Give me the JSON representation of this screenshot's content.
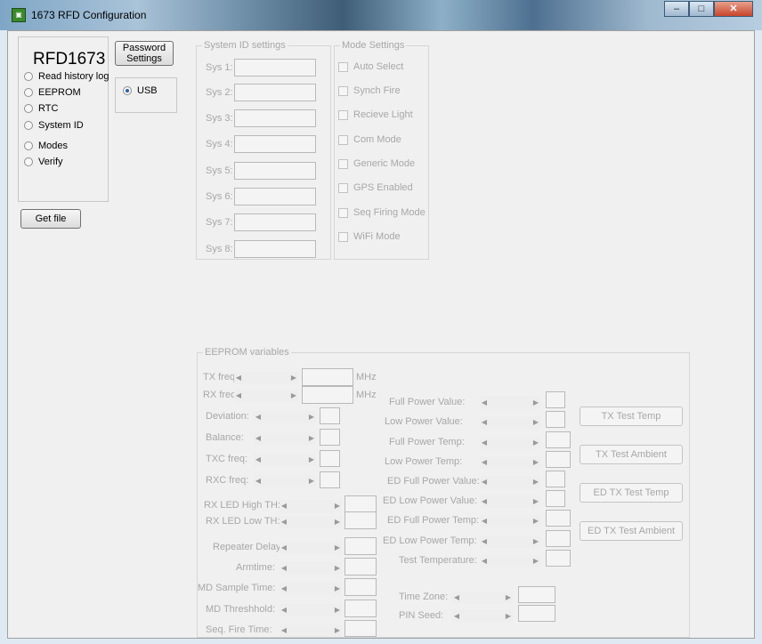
{
  "window": {
    "title": "1673 RFD Configuration",
    "controls": [
      "–",
      "□",
      "✕"
    ]
  },
  "left": {
    "brand": "RFD1673",
    "options": [
      "Read history log",
      "EEPROM",
      "RTC",
      "System ID",
      "Modes",
      "Verify"
    ],
    "get_file": "Get file"
  },
  "password": {
    "line1": "Password",
    "line2": "Settings"
  },
  "conn": {
    "usb": "USB"
  },
  "sysid": {
    "legend": "System ID settings",
    "labels": [
      "Sys 1:",
      "Sys 2:",
      "Sys 3:",
      "Sys 4:",
      "Sys 5:",
      "Sys 6:",
      "Sys 7:",
      "Sys 8:"
    ]
  },
  "modes": {
    "legend": "Mode Settings",
    "items": [
      "Auto Select",
      "Synch Fire",
      "Recieve Light",
      "Com Mode",
      "Generic Mode",
      "GPS Enabled",
      "Seq Firing Mode",
      "WiFi Mode"
    ]
  },
  "eeprom": {
    "legend": "EEPROM variables",
    "txfreq": "TX freq:",
    "rxfreq": "RX freq:",
    "unit": "MHz",
    "left_labels": [
      "Deviation:",
      "Balance:",
      "TXC freq:",
      "RXC freq:"
    ],
    "rxled_labels": [
      "RX LED High TH:",
      "RX LED Low TH:"
    ],
    "lower_labels": [
      "Repeater Delay:",
      "Armtime:",
      "MD Sample Time:",
      "MD Threshhold:",
      "Seq. Fire Time:"
    ],
    "power_labels": [
      "Full Power Value:",
      "Low Power Value:",
      "Full Power Temp:",
      "Low Power Temp:",
      "ED Full Power Value:",
      "ED Low Power Value:",
      "ED Full Power Temp:",
      "ED Low Power Temp:",
      "Test Temperature:"
    ],
    "tz_labels": [
      "Time Zone:",
      "PIN Seed:"
    ],
    "buttons": [
      "TX Test Temp",
      "TX Test Ambient",
      "ED TX Test Temp",
      "ED TX Test Ambient"
    ]
  }
}
